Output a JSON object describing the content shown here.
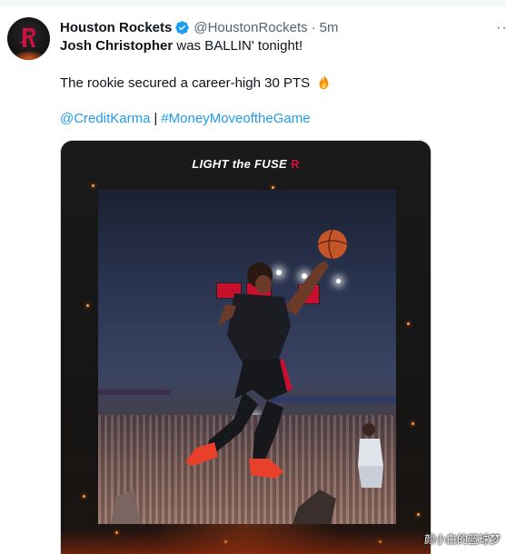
{
  "tweet": {
    "display_name": "Houston Rockets",
    "handle": "@HoustonRockets",
    "separator": "·",
    "time": "5m",
    "line1_strong": "Josh Christopher",
    "line1_rest": " was BALLIN' tonight!",
    "line2": "The rookie secured a career-high 30 PTS",
    "line2_icon": "fire-emoji",
    "hashtag1": "@CreditKarma",
    "divider": "|",
    "hashtag2": "#MoneyMoveoftheGame",
    "more_menu": "···"
  },
  "media": {
    "logo_text": "LIGHT the FUSE",
    "logo_mark": "Ɍ"
  },
  "watermark": "颜小白的篮球梦",
  "colors": {
    "link": "#1d9bf0",
    "verified": "#1d9bf0",
    "text": "#0f1419",
    "secondary": "#536471",
    "rockets_red": "#ce1141"
  }
}
